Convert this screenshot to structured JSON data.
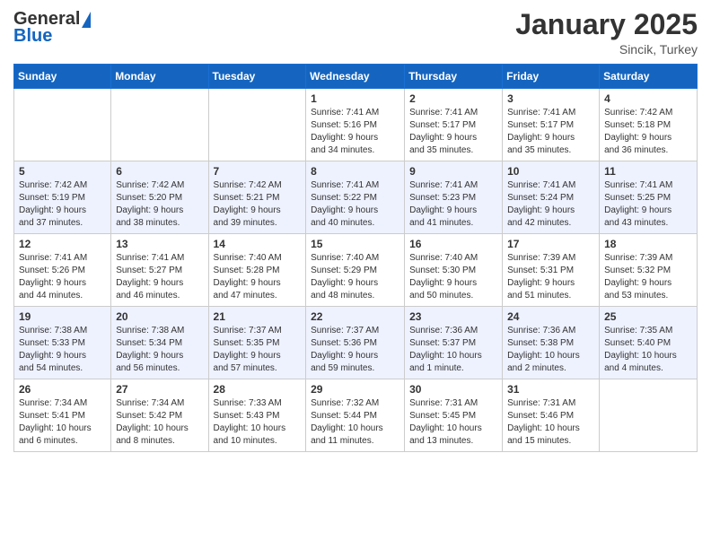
{
  "header": {
    "logo": {
      "general": "General",
      "blue": "Blue",
      "line2": "Blue"
    },
    "month": "January 2025",
    "location": "Sincik, Turkey"
  },
  "weekdays": [
    "Sunday",
    "Monday",
    "Tuesday",
    "Wednesday",
    "Thursday",
    "Friday",
    "Saturday"
  ],
  "weeks": [
    [
      {
        "day": "",
        "content": ""
      },
      {
        "day": "",
        "content": ""
      },
      {
        "day": "",
        "content": ""
      },
      {
        "day": "1",
        "content": "Sunrise: 7:41 AM\nSunset: 5:16 PM\nDaylight: 9 hours\nand 34 minutes."
      },
      {
        "day": "2",
        "content": "Sunrise: 7:41 AM\nSunset: 5:17 PM\nDaylight: 9 hours\nand 35 minutes."
      },
      {
        "day": "3",
        "content": "Sunrise: 7:41 AM\nSunset: 5:17 PM\nDaylight: 9 hours\nand 35 minutes."
      },
      {
        "day": "4",
        "content": "Sunrise: 7:42 AM\nSunset: 5:18 PM\nDaylight: 9 hours\nand 36 minutes."
      }
    ],
    [
      {
        "day": "5",
        "content": "Sunrise: 7:42 AM\nSunset: 5:19 PM\nDaylight: 9 hours\nand 37 minutes."
      },
      {
        "day": "6",
        "content": "Sunrise: 7:42 AM\nSunset: 5:20 PM\nDaylight: 9 hours\nand 38 minutes."
      },
      {
        "day": "7",
        "content": "Sunrise: 7:42 AM\nSunset: 5:21 PM\nDaylight: 9 hours\nand 39 minutes."
      },
      {
        "day": "8",
        "content": "Sunrise: 7:41 AM\nSunset: 5:22 PM\nDaylight: 9 hours\nand 40 minutes."
      },
      {
        "day": "9",
        "content": "Sunrise: 7:41 AM\nSunset: 5:23 PM\nDaylight: 9 hours\nand 41 minutes."
      },
      {
        "day": "10",
        "content": "Sunrise: 7:41 AM\nSunset: 5:24 PM\nDaylight: 9 hours\nand 42 minutes."
      },
      {
        "day": "11",
        "content": "Sunrise: 7:41 AM\nSunset: 5:25 PM\nDaylight: 9 hours\nand 43 minutes."
      }
    ],
    [
      {
        "day": "12",
        "content": "Sunrise: 7:41 AM\nSunset: 5:26 PM\nDaylight: 9 hours\nand 44 minutes."
      },
      {
        "day": "13",
        "content": "Sunrise: 7:41 AM\nSunset: 5:27 PM\nDaylight: 9 hours\nand 46 minutes."
      },
      {
        "day": "14",
        "content": "Sunrise: 7:40 AM\nSunset: 5:28 PM\nDaylight: 9 hours\nand 47 minutes."
      },
      {
        "day": "15",
        "content": "Sunrise: 7:40 AM\nSunset: 5:29 PM\nDaylight: 9 hours\nand 48 minutes."
      },
      {
        "day": "16",
        "content": "Sunrise: 7:40 AM\nSunset: 5:30 PM\nDaylight: 9 hours\nand 50 minutes."
      },
      {
        "day": "17",
        "content": "Sunrise: 7:39 AM\nSunset: 5:31 PM\nDaylight: 9 hours\nand 51 minutes."
      },
      {
        "day": "18",
        "content": "Sunrise: 7:39 AM\nSunset: 5:32 PM\nDaylight: 9 hours\nand 53 minutes."
      }
    ],
    [
      {
        "day": "19",
        "content": "Sunrise: 7:38 AM\nSunset: 5:33 PM\nDaylight: 9 hours\nand 54 minutes."
      },
      {
        "day": "20",
        "content": "Sunrise: 7:38 AM\nSunset: 5:34 PM\nDaylight: 9 hours\nand 56 minutes."
      },
      {
        "day": "21",
        "content": "Sunrise: 7:37 AM\nSunset: 5:35 PM\nDaylight: 9 hours\nand 57 minutes."
      },
      {
        "day": "22",
        "content": "Sunrise: 7:37 AM\nSunset: 5:36 PM\nDaylight: 9 hours\nand 59 minutes."
      },
      {
        "day": "23",
        "content": "Sunrise: 7:36 AM\nSunset: 5:37 PM\nDaylight: 10 hours\nand 1 minute."
      },
      {
        "day": "24",
        "content": "Sunrise: 7:36 AM\nSunset: 5:38 PM\nDaylight: 10 hours\nand 2 minutes."
      },
      {
        "day": "25",
        "content": "Sunrise: 7:35 AM\nSunset: 5:40 PM\nDaylight: 10 hours\nand 4 minutes."
      }
    ],
    [
      {
        "day": "26",
        "content": "Sunrise: 7:34 AM\nSunset: 5:41 PM\nDaylight: 10 hours\nand 6 minutes."
      },
      {
        "day": "27",
        "content": "Sunrise: 7:34 AM\nSunset: 5:42 PM\nDaylight: 10 hours\nand 8 minutes."
      },
      {
        "day": "28",
        "content": "Sunrise: 7:33 AM\nSunset: 5:43 PM\nDaylight: 10 hours\nand 10 minutes."
      },
      {
        "day": "29",
        "content": "Sunrise: 7:32 AM\nSunset: 5:44 PM\nDaylight: 10 hours\nand 11 minutes."
      },
      {
        "day": "30",
        "content": "Sunrise: 7:31 AM\nSunset: 5:45 PM\nDaylight: 10 hours\nand 13 minutes."
      },
      {
        "day": "31",
        "content": "Sunrise: 7:31 AM\nSunset: 5:46 PM\nDaylight: 10 hours\nand 15 minutes."
      },
      {
        "day": "",
        "content": ""
      }
    ]
  ]
}
